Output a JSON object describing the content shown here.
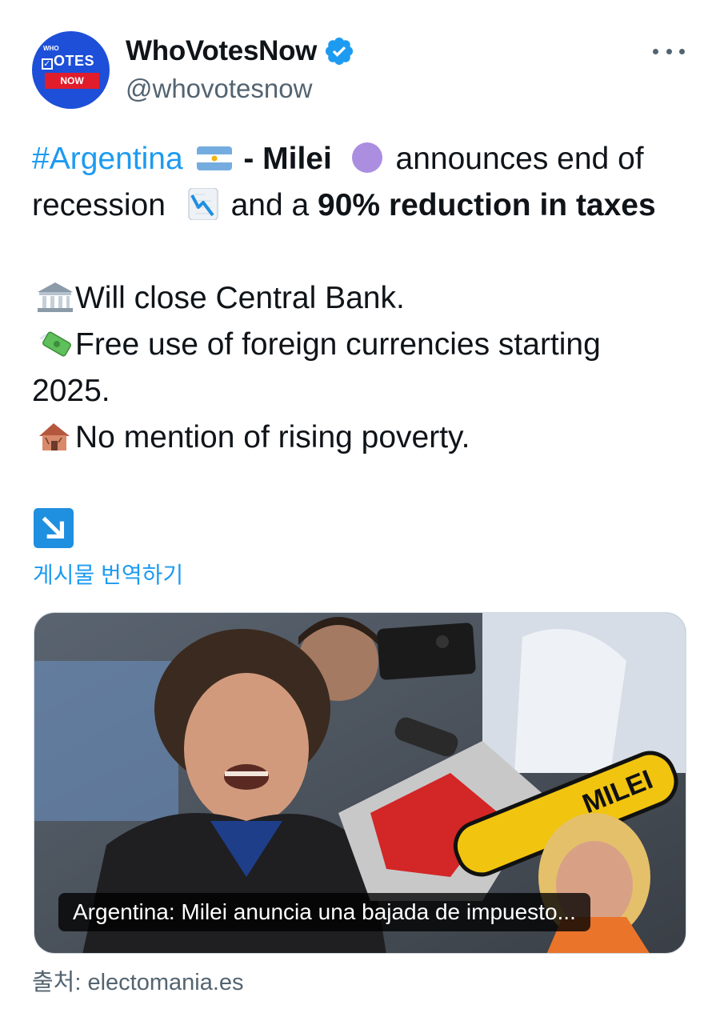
{
  "tweet": {
    "display_name": "WhoVotesNow",
    "handle": "@whovotesnow",
    "avatar": {
      "small_text": "WHO",
      "big_text": "OTES",
      "badge_text": "NOW"
    },
    "body": {
      "line1": {
        "hashtag": "#Argentina",
        "dash_name": " - Milei",
        "rest": " announces end of"
      },
      "line2": {
        "pre": "recession",
        "mid": " and a ",
        "bold_pct": "90%",
        "bold_rest": " reduction in taxes"
      },
      "line3": "Will close Central Bank.",
      "line4": "Free use of foreign currencies starting",
      "line5": "2025.",
      "line6": "No mention of rising poverty."
    },
    "translate_label": "게시물 번역하기",
    "card_caption": "Argentina: Milei anuncia una bajada de impuesto...",
    "source_label": "출처: electomania.es"
  },
  "icons": {
    "verified": "verified-badge-icon",
    "more": "more-options-icon",
    "argentina_flag": "argentina-flag-emoji",
    "purple_circle": "purple-circle-emoji",
    "chart_down": "chart-decreasing-emoji",
    "bank": "bank-emoji",
    "money_wings": "money-with-wings-emoji",
    "derelict_house": "derelict-house-emoji",
    "arrow_down_right": "down-right-arrow-emoji"
  },
  "colors": {
    "link": "#1d9bf0",
    "secondary": "#536471",
    "verified": "#1d9bf0",
    "purple_circle": "#ab8ee0"
  }
}
